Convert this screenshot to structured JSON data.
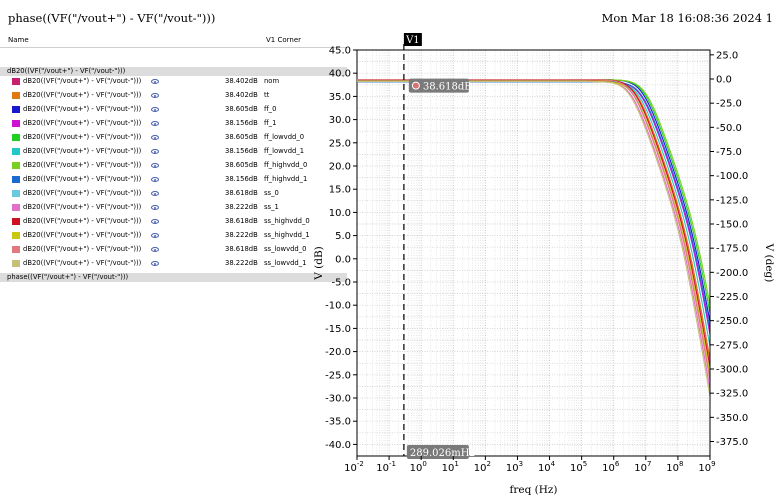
{
  "title": "phase((VF(\"/vout+\") - VF(\"/vout-\")))",
  "timestamp": "Mon Mar 18 16:08:36 2024   1",
  "legend": {
    "col_name": "Name",
    "col_corner": "V1 Corner",
    "group1": "dB20((VF(\"/vout+\") - VF(\"/vout-\")))",
    "group2": "phase((VF(\"/vout+\") - VF(\"/vout-\")))",
    "rows": [
      {
        "name": "dB20((VF(\"/vout+\") - VF(\"/vout-\")))",
        "value": "38.402dB",
        "corner": "nom",
        "color": "#c8206e"
      },
      {
        "name": "dB20((VF(\"/vout+\") - VF(\"/vout-\")))",
        "value": "38.402dB",
        "corner": "tt",
        "color": "#e07a10"
      },
      {
        "name": "dB20((VF(\"/vout+\") - VF(\"/vout-\")))",
        "value": "38.605dB",
        "corner": "ff_0",
        "color": "#1818d0"
      },
      {
        "name": "dB20((VF(\"/vout+\") - VF(\"/vout-\")))",
        "value": "38.156dB",
        "corner": "ff_1",
        "color": "#d010d0"
      },
      {
        "name": "dB20((VF(\"/vout+\") - VF(\"/vout-\")))",
        "value": "38.605dB",
        "corner": "ff_lowvdd_0",
        "color": "#20d020"
      },
      {
        "name": "dB20((VF(\"/vout+\") - VF(\"/vout-\")))",
        "value": "38.156dB",
        "corner": "ff_lowvdd_1",
        "color": "#20c8c8"
      },
      {
        "name": "dB20((VF(\"/vout+\") - VF(\"/vout-\")))",
        "value": "38.605dB",
        "corner": "ff_highvdd_0",
        "color": "#78d020"
      },
      {
        "name": "dB20((VF(\"/vout+\") - VF(\"/vout-\")))",
        "value": "38.156dB",
        "corner": "ff_highvdd_1",
        "color": "#1a6ad0"
      },
      {
        "name": "dB20((VF(\"/vout+\") - VF(\"/vout-\")))",
        "value": "38.618dB",
        "corner": "ss_0",
        "color": "#6ac8e0"
      },
      {
        "name": "dB20((VF(\"/vout+\") - VF(\"/vout-\")))",
        "value": "38.222dB",
        "corner": "ss_1",
        "color": "#e070c8"
      },
      {
        "name": "dB20((VF(\"/vout+\") - VF(\"/vout-\")))",
        "value": "38.618dB",
        "corner": "ss_highvdd_0",
        "color": "#d01020"
      },
      {
        "name": "dB20((VF(\"/vout+\") - VF(\"/vout-\")))",
        "value": "38.222dB",
        "corner": "ss_highvdd_1",
        "color": "#c8c810"
      },
      {
        "name": "dB20((VF(\"/vout+\") - VF(\"/vout-\")))",
        "value": "38.618dB",
        "corner": "ss_lowvdd_0",
        "color": "#e07a80"
      },
      {
        "name": "dB20((VF(\"/vout+\") - VF(\"/vout-\")))",
        "value": "38.222dB",
        "corner": "ss_lowvdd_1",
        "color": "#c8c078"
      }
    ]
  },
  "chart_data": {
    "type": "line",
    "xlabel": "freq (Hz)",
    "ylabel_left": "V (dB)",
    "ylabel_right": "V (deg)",
    "x_scale": "log",
    "xlim": [
      0.01,
      1000000000
    ],
    "x_ticks": [
      "10-2",
      "10-1",
      "100",
      "101",
      "102",
      "103",
      "104",
      "105",
      "106",
      "107",
      "108",
      "109"
    ],
    "ylim_left": [
      -42.5,
      45.0
    ],
    "y_ticks_left": [
      45.0,
      40.0,
      35.0,
      30.0,
      25.0,
      20.0,
      15.0,
      10.0,
      5.0,
      0.0,
      -5.0,
      -10.0,
      -15.0,
      -20.0,
      -25.0,
      -30.0,
      -35.0,
      -40.0
    ],
    "ylim_right": [
      -390,
      30
    ],
    "y_ticks_right": [
      25.0,
      0.0,
      -25.0,
      -50.0,
      -75.0,
      -100.0,
      -125.0,
      -150.0,
      -175.0,
      -200.0,
      -225.0,
      -250.0,
      -275.0,
      -300.0,
      -325.0,
      -350.0,
      -375.0
    ],
    "grid": true,
    "cursor": {
      "name": "V1",
      "x": 0.289026,
      "x_label": "289.026mHz",
      "y_label": "38.618dB",
      "dot_color": "#d87070"
    },
    "series": [
      {
        "color": "#c8206e",
        "gain_db": 38.402,
        "pole_hz": 5000000
      },
      {
        "color": "#e07a10",
        "gain_db": 38.402,
        "pole_hz": 5000000
      },
      {
        "color": "#1818d0",
        "gain_db": 38.605,
        "pole_hz": 8000000
      },
      {
        "color": "#d010d0",
        "gain_db": 38.156,
        "pole_hz": 7000000
      },
      {
        "color": "#20d020",
        "gain_db": 38.605,
        "pole_hz": 9000000
      },
      {
        "color": "#20c8c8",
        "gain_db": 38.156,
        "pole_hz": 6000000
      },
      {
        "color": "#78d020",
        "gain_db": 38.605,
        "pole_hz": 10000000
      },
      {
        "color": "#1a6ad0",
        "gain_db": 38.156,
        "pole_hz": 7500000
      },
      {
        "color": "#6ac8e0",
        "gain_db": 38.618,
        "pole_hz": 4000000
      },
      {
        "color": "#e070c8",
        "gain_db": 38.222,
        "pole_hz": 3500000
      },
      {
        "color": "#d01020",
        "gain_db": 38.618,
        "pole_hz": 4500000
      },
      {
        "color": "#c8c810",
        "gain_db": 38.222,
        "pole_hz": 4200000
      },
      {
        "color": "#e07a80",
        "gain_db": 38.618,
        "pole_hz": 3800000
      },
      {
        "color": "#c8c078",
        "gain_db": 38.222,
        "pole_hz": 3200000
      }
    ]
  }
}
